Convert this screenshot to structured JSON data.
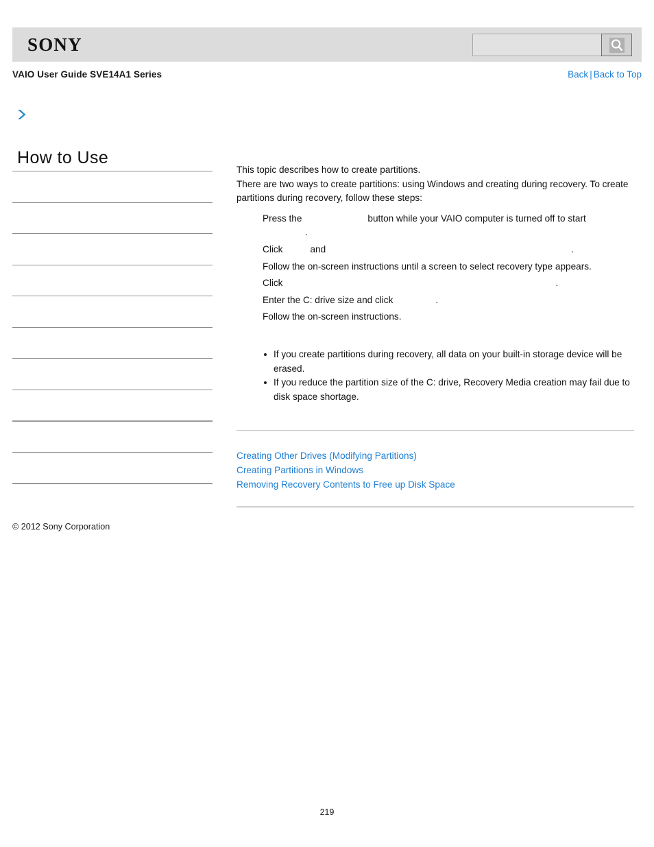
{
  "header": {
    "logo_text": "SONY",
    "search": {
      "value": "",
      "placeholder": "",
      "icon": "search-icon"
    }
  },
  "subheader": {
    "guide_title": "VAIO User Guide SVE14A1 Series",
    "back_label": "Back",
    "separator": "|",
    "back_to_top_label": "Back to Top"
  },
  "sidebar": {
    "expand_icon": "chevron-right-icon",
    "section_title": "How to Use",
    "items": [
      {
        "label": ""
      },
      {
        "label": ""
      },
      {
        "label": ""
      },
      {
        "label": ""
      },
      {
        "label": ""
      },
      {
        "label": ""
      },
      {
        "label": ""
      },
      {
        "label": ""
      },
      {
        "label": ""
      },
      {
        "label": ""
      },
      {
        "label": ""
      }
    ]
  },
  "main": {
    "intro_line_1": "This topic describes how to create partitions.",
    "intro_line_2": "There are two ways to create partitions: using Windows and creating during recovery. To create partitions during recovery, follow these steps:",
    "steps": [
      {
        "text_before": "Press the",
        "text_after": "button while your VAIO computer is turned off to start",
        "continuation": "."
      },
      {
        "text_before": "Click",
        "text_middle": "and",
        "text_after": "."
      },
      {
        "text_before": "Follow the on-screen instructions until a screen to select recovery type appears."
      },
      {
        "text_before": "Click",
        "text_after": "."
      },
      {
        "text_before": "Enter the C: drive size and click",
        "text_after": "."
      },
      {
        "text_before": "Follow the on-screen instructions."
      }
    ],
    "notes": [
      "If you create partitions during recovery, all data on your built-in storage device will be erased.",
      "If you reduce the partition size of the C: drive, Recovery Media creation may fail due to disk space shortage."
    ],
    "related_links": [
      "Creating Other Drives (Modifying Partitions)",
      "Creating Partitions in Windows",
      "Removing Recovery Contents to Free up Disk Space"
    ]
  },
  "footer": {
    "copyright": "© 2012 Sony Corporation",
    "page_number": "219"
  },
  "colors": {
    "link": "#1d7fd4",
    "header_bg": "#dcdcdc",
    "accent": "#2e8bc8"
  }
}
